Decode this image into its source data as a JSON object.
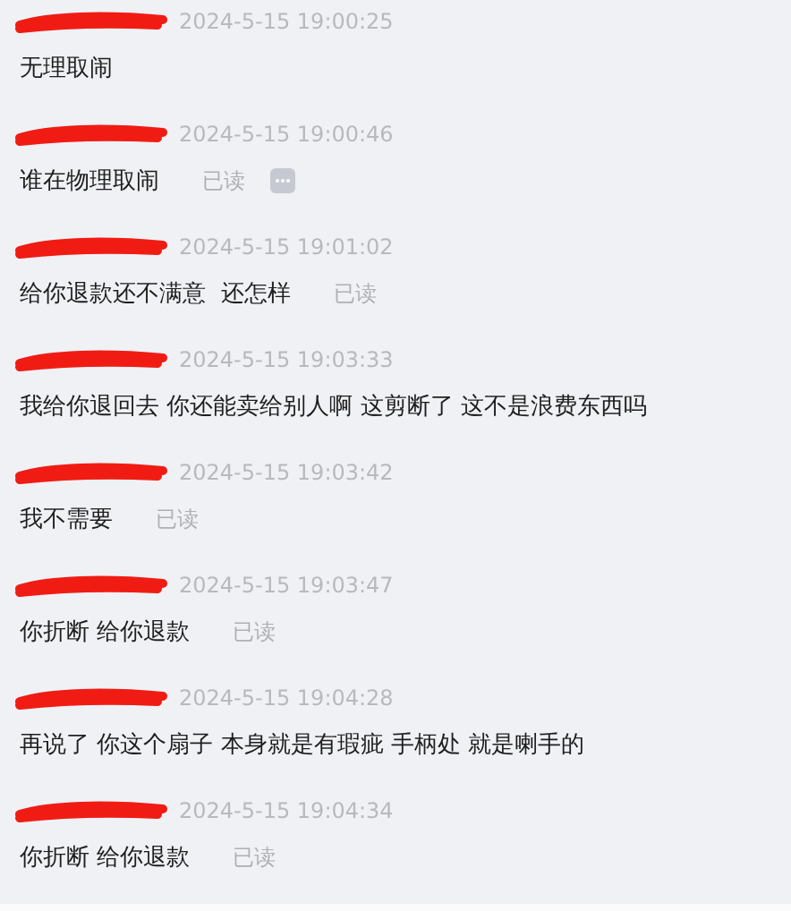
{
  "messages": [
    {
      "time": "2024-5-15 19:00:25",
      "text": "无理取闹",
      "menu_icon": false
    },
    {
      "time": "2024-5-15 19:00:46",
      "text": "谁在物理取闹",
      "status": "已读",
      "menu_icon": true
    },
    {
      "time": "2024-5-15 19:01:02",
      "text": "给你退款还不满意  还怎样",
      "status": "已读",
      "menu_icon": false
    },
    {
      "time": "2024-5-15 19:03:33",
      "text": "我给你退回去 你还能卖给别人啊 这剪断了 这不是浪费东西吗",
      "menu_icon": false
    },
    {
      "time": "2024-5-15 19:03:42",
      "text": "我不需要",
      "status": "已读",
      "menu_icon": false
    },
    {
      "time": "2024-5-15 19:03:47",
      "text": "你折断 给你退款",
      "status": "已读",
      "menu_icon": false
    },
    {
      "time": "2024-5-15 19:04:28",
      "text": "再说了 你这个扇子 本身就是有瑕疵 手柄处 就是喇手的",
      "menu_icon": false
    },
    {
      "time": "2024-5-15 19:04:34",
      "text": "你折断 给你退款",
      "status": "已读",
      "menu_icon": false
    }
  ]
}
